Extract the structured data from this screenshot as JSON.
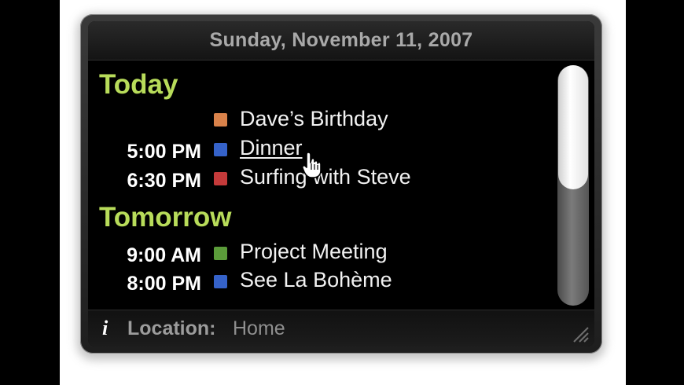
{
  "header": {
    "date": "Sunday, November 11, 2007"
  },
  "sections": [
    {
      "title": "Today",
      "events": [
        {
          "time": "",
          "title": "Dave’s Birthday",
          "color": "#d9824a"
        },
        {
          "time": "5:00 PM",
          "title": "Dinner",
          "color": "#3562c9",
          "hovered": true
        },
        {
          "time": "6:30 PM",
          "title": "Surfing with Steve",
          "color": "#c43a3a"
        }
      ]
    },
    {
      "title": "Tomorrow",
      "events": [
        {
          "time": "9:00 AM",
          "title": "Project Meeting",
          "color": "#5b9c3a"
        },
        {
          "time": "8:00 PM",
          "title": "See La Bohème",
          "color": "#3562c9"
        }
      ]
    }
  ],
  "footer": {
    "info_icon": "i",
    "location_label": "Location:",
    "location_value": "Home"
  },
  "icons": {
    "info": "info-icon",
    "resize": "resize-grip-icon",
    "cursor": "hand-pointer-icon"
  }
}
